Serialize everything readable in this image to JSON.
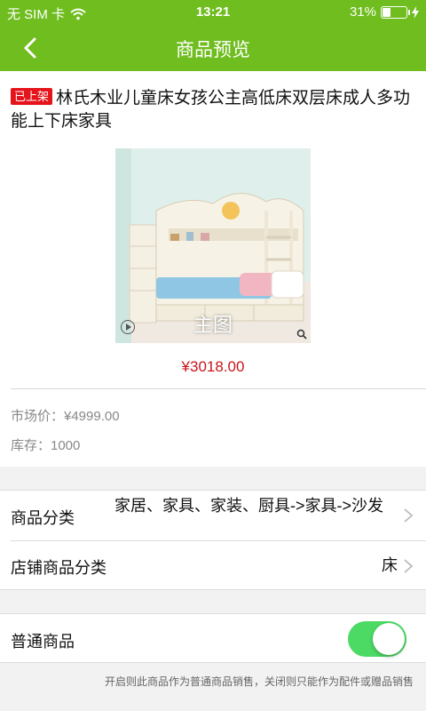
{
  "status_bar": {
    "carrier": "无 SIM 卡",
    "time": "13:21",
    "battery": "31%",
    "battery_level": 0.31,
    "icons": [
      "wifi-icon",
      "battery-icon",
      "charging-icon"
    ]
  },
  "nav": {
    "title": "商品预览",
    "back_icon": "chevron-left-icon"
  },
  "product": {
    "badge": "已上架",
    "name": "林氏木业儿童床女孩公主高低床双层床成人多功能上下床家具",
    "main_image_caption": "主图",
    "price": "¥3018.00",
    "market_price": "市场价：¥4999.00",
    "stock": "库存：1000"
  },
  "category": {
    "label": "商品分类",
    "value": "家居、家具、家装、厨具->家具->沙发"
  },
  "store_category": {
    "label": "店铺商品分类",
    "value": "床"
  },
  "normal_goods": {
    "label": "普通商品",
    "enabled": true,
    "hint": "开启则此商品作为普通商品销售，关闭则只能作为配件或赠品销售"
  },
  "colors": {
    "brand_green": "#6fbd1f",
    "badge_red": "#e5141a",
    "price_red": "#c8161d",
    "toggle_on": "#4cd964"
  }
}
